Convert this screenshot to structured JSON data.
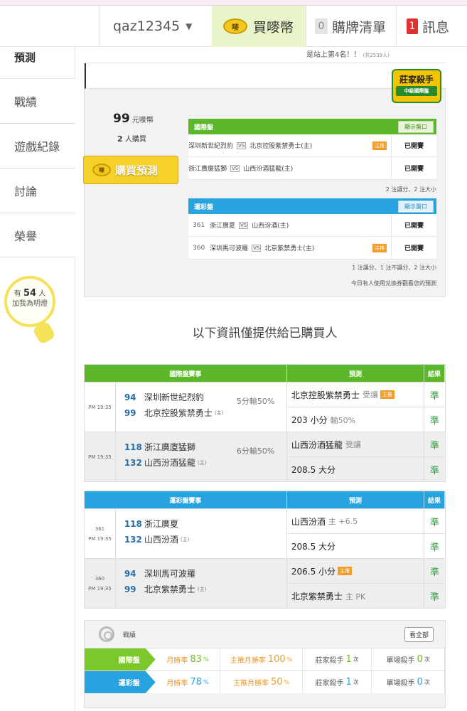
{
  "nav": {
    "username": "qaz12345",
    "coin_label": "買嘜幣",
    "coin_icon_text": "嘜",
    "cart_count": "0",
    "cart_label": "購牌清單",
    "msg_count": "1",
    "msg_label": "訊息"
  },
  "sidebar": {
    "active": "預測",
    "items": [
      "戰績",
      "遊戲紀錄",
      "討論",
      "榮譽"
    ],
    "bulb_prefix": "有",
    "bulb_count": "54",
    "bulb_unit": "人",
    "bulb_text": "加我為明燈"
  },
  "prediction": {
    "rank_text": "是站上第4名！！",
    "rank_small": "(共2539人)",
    "stamp_title": "莊家殺手",
    "stamp_sub": "中級國際盤",
    "price": "99",
    "price_unit": "元嘜幣",
    "buyers": "2",
    "buyers_unit": "人購買",
    "buy_button": "購買預測",
    "show_button": "顯示盤口",
    "intl_label": "國際盤",
    "intl_games": [
      {
        "home_badge": "",
        "team1": "深圳新世紀烈豹",
        "team2": "北京控股紫禁勇士(主)",
        "tag": "主推",
        "status": "已開賽"
      },
      {
        "home_badge": "",
        "team1": "浙江廣廈猛獅",
        "team2": "山西汾酒猛龍(主)",
        "tag": "",
        "status": "已開賽"
      }
    ],
    "intl_note": "2 注讓分、2 注大小",
    "lottery_label": "運彩盤",
    "lottery_games": [
      {
        "no": "361",
        "team1": "浙江廣夏",
        "team2": "山西汾酒(主)",
        "tag": "",
        "status": "已開賽"
      },
      {
        "no": "360",
        "team1": "深圳馬可波羅",
        "team2": "北京紫禁勇士(主)",
        "tag": "主推",
        "status": "已開賽"
      }
    ],
    "lottery_note": "1 注讓分、1 注不讓分、2 注大小",
    "coupon_note": "今日有人使用兌換券觀看您的預測",
    "vs": "VS"
  },
  "info_title": "以下資訊僅提供給已購買人",
  "intl_table": {
    "headers": [
      "國際盤賽事",
      "預測",
      "結果"
    ],
    "games": [
      {
        "time": "PM 19:35",
        "no": "",
        "n1": "94",
        "t1": "深圳新世紀烈豹",
        "n2": "99",
        "t2": "北京控股紫禁勇士",
        "h": "(主)",
        "spread": "5分輸50%",
        "pick1": "北京控股紫禁勇士",
        "pick1_sub": "受讓",
        "pick1_tag": "主推",
        "pick2": "203 小分",
        "pick2_sub": "輸50%",
        "r1": "準",
        "r2": "準"
      },
      {
        "time": "PM 19:35",
        "no": "",
        "n1": "118",
        "t1": "浙江廣廈猛獅",
        "n2": "132",
        "t2": "山西汾酒猛龍",
        "h": "(主)",
        "spread": "6分輸50%",
        "pick1": "山西汾酒猛龍",
        "pick1_sub": "受讓",
        "pick1_tag": "",
        "pick2": "208.5 大分",
        "pick2_sub": "",
        "r1": "準",
        "r2": "準"
      }
    ]
  },
  "lottery_table": {
    "headers": [
      "運彩盤賽事",
      "預測",
      "結果"
    ],
    "games": [
      {
        "time": "PM 19:35",
        "no": "361",
        "n1": "118",
        "t1": "浙江廣夏",
        "n2": "132",
        "t2": "山西汾酒",
        "h": "(主)",
        "spread": "",
        "pick1": "山西汾酒",
        "pick1_sub": "主 +6.5",
        "pick1_tag": "",
        "pick2": "208.5 大分",
        "pick2_sub": "",
        "r1": "準",
        "r2": "準"
      },
      {
        "time": "PM 19:35",
        "no": "360",
        "n1": "94",
        "t1": "深圳馬可波羅",
        "n2": "99",
        "t2": "北京紫禁勇士",
        "h": "(主)",
        "spread": "",
        "pick1": "206.5 小分",
        "pick1_sub": "",
        "pick1_tag": "主推",
        "pick2": "北京紫禁勇士",
        "pick2_sub": "主 PK",
        "r1": "準",
        "r2": "準"
      }
    ]
  },
  "stats": {
    "title": "戰績",
    "view_all": "看全部",
    "rows": [
      {
        "label": "國際盤",
        "c1_label": "月勝率",
        "c1_val": "83",
        "c2_label": "主推月勝率",
        "c2_val": "100",
        "c3_label": "莊家殺手",
        "c3_val": "1",
        "c4_label": "單場殺手",
        "c4_val": "0",
        "pct": "%",
        "times": "次"
      },
      {
        "label": "運彩盤",
        "c1_label": "月勝率",
        "c1_val": "78",
        "c2_label": "主推月勝率",
        "c2_val": "50",
        "c3_label": "莊家殺手",
        "c3_val": "1",
        "c4_label": "單場殺手",
        "c4_val": "0",
        "pct": "%",
        "times": "次"
      }
    ]
  },
  "colors": {
    "green": "#5cb82a",
    "blue": "#27a3e0",
    "orange": "#f39c2a",
    "result_green": "#2a9a3a"
  }
}
